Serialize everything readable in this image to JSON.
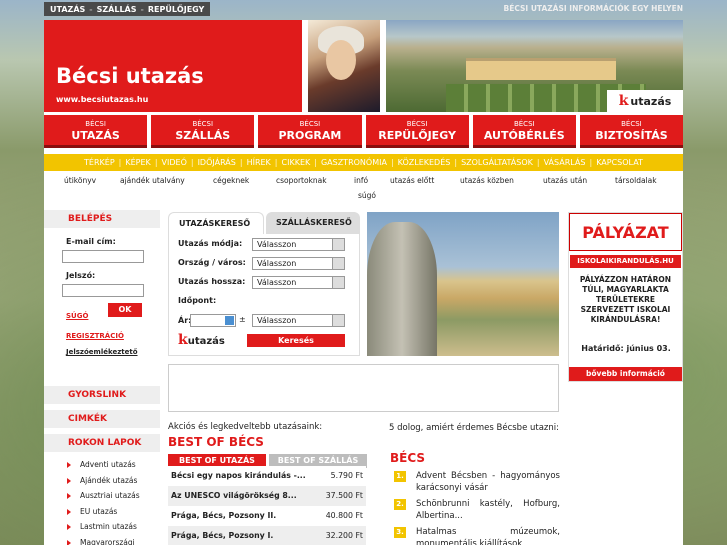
{
  "topnav": {
    "items": [
      "UTAZÁS",
      "SZÁLLÁS",
      "REPÜLŐJEGY"
    ],
    "sep": "-",
    "tagline": "BÉCSI UTAZÁSI INFORMÁCIÓK EGY HELYEN"
  },
  "header": {
    "title": "Bécsi utazás",
    "url": "www.becsiutazas.hu",
    "brand": "utazás",
    "brand_mark": "k"
  },
  "mainnav": [
    {
      "small": "BÉCSI",
      "label": "UTAZÁS"
    },
    {
      "small": "BÉCSI",
      "label": "SZÁLLÁS"
    },
    {
      "small": "BÉCSI",
      "label": "PROGRAM"
    },
    {
      "small": "BÉCSI",
      "label": "REPÜLŐJEGY"
    },
    {
      "small": "BÉCSI",
      "label": "AUTÓBÉRLÉS"
    },
    {
      "small": "BÉCSI",
      "label": "BIZTOSÍTÁS"
    }
  ],
  "catnav": [
    "TÉRKÉP",
    "KÉPEK",
    "VIDEÓ",
    "IDŐJÁRÁS",
    "HÍREK",
    "CIKKEK",
    "GASZTRONÓMIA",
    "KÖZLEKEDÉS",
    "SZOLGÁLTATÁSOK",
    "VÁSÁRLÁS",
    "KAPCSOLAT"
  ],
  "catnav_sep": "|",
  "subnav": [
    "útikönyv",
    "ajándék utalvány",
    "cégeknek",
    "csoportoknak",
    "infó",
    "utazás előtt",
    "utazás közben",
    "utazás után",
    "társoldalak",
    "súgó"
  ],
  "login": {
    "heading": "BELÉPÉS",
    "email_label": "E-mail cím:",
    "password_label": "Jelszó:",
    "help": "SÚGÓ",
    "ok": "OK",
    "register": "REGISZTRÁCIÓ",
    "forgot": "Jelszóemlékeztető"
  },
  "sidebar": {
    "gyorslink": "GYORSLINK",
    "cimkek": "CIMKÉK",
    "rokon": "ROKON LAPOK",
    "rokon_items": [
      "Adventi utazás",
      "Ajándék utazás",
      "Ausztriai utazás",
      "EU utazás",
      "Lastmin utazás",
      "Magyarországi utazás"
    ]
  },
  "search": {
    "tab1": "UTAZÁSKERESŐ",
    "tab2": "SZÁLLÁSKERESŐ",
    "rows": [
      {
        "label": "Utazás módja:",
        "value": "Válasszon"
      },
      {
        "label": "Ország / város:",
        "value": "Válasszon"
      },
      {
        "label": "Utazás hossza:",
        "value": "Válasszon"
      }
    ],
    "idopont": "Időpont:",
    "ar": "Ár:",
    "pm": "±",
    "ar_value": "Válasszon",
    "button": "Keresés",
    "brand": "utazás",
    "brand_mark": "k"
  },
  "banner": {
    "title": "PÁLYÁZAT",
    "url": "ISKOLAIKIRANDULÁS.HU",
    "text": "PÁLYÁZZON HATÁRON TÚLI, MAGYARLAKTA TERÜLETEKRE SZERVEZETT ISKOLAI KIRÁNDULÁSRA!",
    "deadline": "Határidő: június 03.",
    "more": "bővebb információ"
  },
  "offers": {
    "intro": "Akciós és legkedveltebb utazásaink:",
    "title": "BEST OF BÉCS",
    "tab1": "BEST OF UTAZÁS",
    "tab2": "BEST OF SZÁLLÁS",
    "rows": [
      {
        "name": "Bécsi egy napos kirándulás -...",
        "price": "5.790 Ft"
      },
      {
        "name": "Az UNESCO világörökség 8...",
        "price": "37.500 Ft"
      },
      {
        "name": "Prága, Bécs, Pozsony II.",
        "price": "40.800 Ft"
      },
      {
        "name": "Prága, Bécs, Pozsony I.",
        "price": "32.200 Ft"
      }
    ]
  },
  "becs": {
    "intro": "5 dolog, amiért érdemes Bécsbe utazni:",
    "title": "BÉCS",
    "items": [
      {
        "num": "1.",
        "text": "Advent Bécsben - hagyományos karácsonyi vásár"
      },
      {
        "num": "2.",
        "text": "Schönbrunni kastély, Hofburg, Albertina..."
      },
      {
        "num": "3.",
        "text": "Hatalmas múzeumok, monumentális kiállítások"
      }
    ]
  },
  "colors": {
    "accent": "#e01b1b",
    "yellow": "#f2c400"
  }
}
